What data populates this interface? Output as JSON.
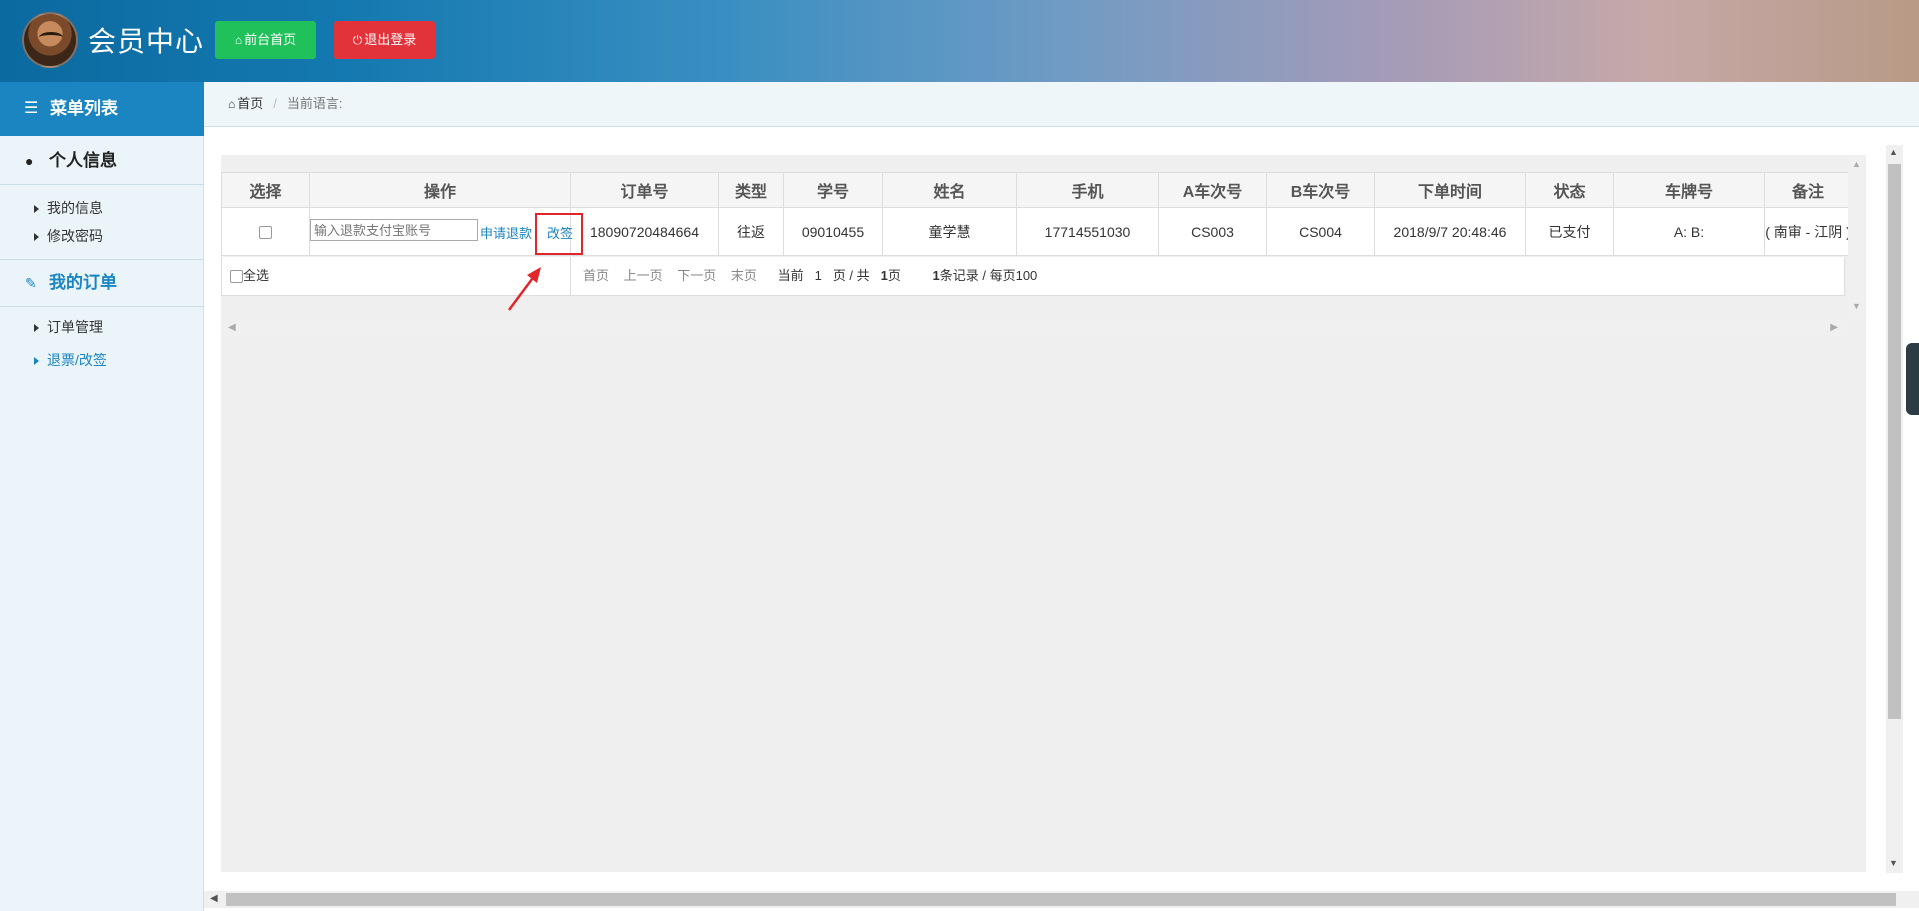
{
  "header": {
    "brand": "会员中心",
    "home_button": "前台首页",
    "logout_button": "退出登录"
  },
  "sidebar": {
    "menu_title": "菜单列表",
    "sections": [
      {
        "title": "个人信息",
        "items": [
          "我的信息",
          "修改密码"
        ]
      },
      {
        "title": "我的订单",
        "items": [
          "订单管理",
          "退票/改签"
        ]
      }
    ],
    "active_item": "退票/改签"
  },
  "breadcrumb": {
    "home": "首页",
    "current": "当前语言:"
  },
  "table": {
    "columns": [
      "选择",
      "操作",
      "订单号",
      "类型",
      "学号",
      "姓名",
      "手机",
      "A车次号",
      "B车次号",
      "下单时间",
      "状态",
      "车牌号",
      "备注"
    ],
    "rows": [
      {
        "payment_account_placeholder": "输入退款支付宝账号",
        "refund_link": "申请退款",
        "change_link": "改签",
        "order_no": "18090720484664",
        "type": "往返",
        "student_no": "09010455",
        "name": "童学慧",
        "phone": "17714551030",
        "a_train": "CS003",
        "b_train": "CS004",
        "order_time": "2018/9/7 20:48:46",
        "status": "已支付",
        "plate": "A: B:",
        "remark": "( 南审 - 江阴 )"
      }
    ],
    "select_all": "全选",
    "pager": {
      "first": "首页",
      "prev": "上一页",
      "next": "下一页",
      "last": "末页",
      "page_prefix": "当前",
      "current_page": "1",
      "page_mid": "页 / 共",
      "total_pages": "1",
      "page_suffix": "页",
      "records": "1",
      "records_suffix": "条记录 / 每页100"
    }
  },
  "colors": {
    "header_start": "#0b6aa0",
    "primary": "#1a85c0",
    "home_button": "#20c15a",
    "logout_button": "#e3333a",
    "highlight": "#e1262b"
  },
  "icons": [
    "home-icon",
    "power-icon",
    "list-icon",
    "user-icon",
    "edit-icon",
    "caret-right-icon",
    "arrow-annotation-icon"
  ]
}
